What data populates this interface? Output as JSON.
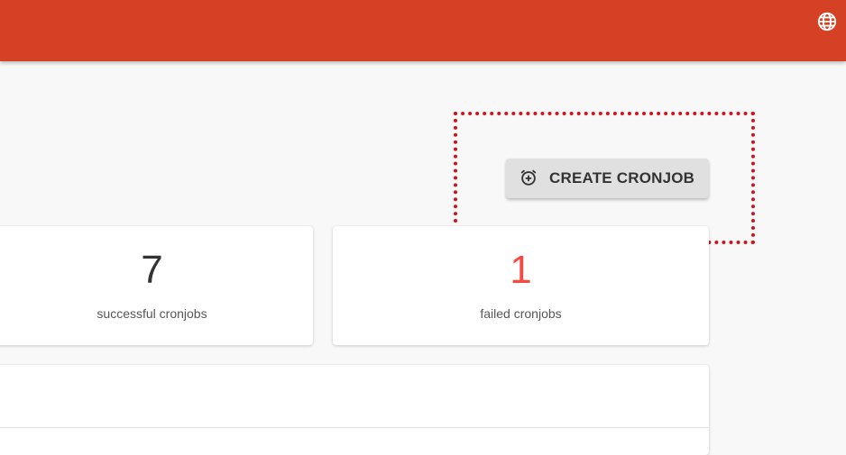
{
  "header": {
    "language_icon": "globe-icon",
    "color": "#d44124"
  },
  "actions": {
    "create_button_label": "CREATE CRONJOB",
    "create_button_icon": "alarm-add-icon"
  },
  "stats": {
    "successful_count": "7",
    "successful_label": "successful cronjobs",
    "failed_count": "1",
    "failed_label": "failed cronjobs",
    "failed_color": "#f44a44"
  },
  "highlight_color": "#d0131a"
}
